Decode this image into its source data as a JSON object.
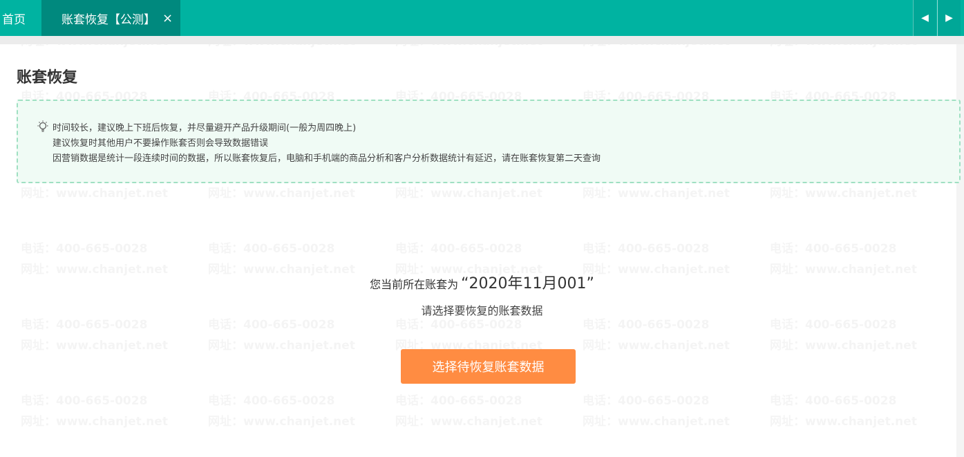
{
  "tabs": {
    "home_label": "首页",
    "active_label": "账套恢复【公测】",
    "close_symbol": "×"
  },
  "nav": {
    "left_symbol": "◀",
    "right_symbol": "▶"
  },
  "watermark": {
    "phone": "电话：400-665-0028",
    "site": "网址：www.chanjet.net"
  },
  "page": {
    "title": "账套恢复"
  },
  "notice": {
    "icon": "lightbulb-icon",
    "lines": [
      "时间较长，建议晚上下班后恢复，并尽量避开产品升级期间(一般为周四晚上)",
      "建议恢复时其他用户不要操作账套否则会导致数据错误",
      "因营销数据是统计一段连续时间的数据，所以账套恢复后，电脑和手机端的商品分析和客户分析数据统计有延迟，请在账套恢复第二天查询"
    ]
  },
  "current_book": {
    "prefix": "您当前所在账套为",
    "name": "“2020年11月001”"
  },
  "prompt": "请选择要恢复的账套数据",
  "select_button_label": "选择待恢复账套数据",
  "colors": {
    "header": "#00b3a1",
    "active_tab": "#00897e",
    "notice_border": "#9fe0c2",
    "notice_bg": "#f0fbf5",
    "button": "#ff8c42"
  }
}
